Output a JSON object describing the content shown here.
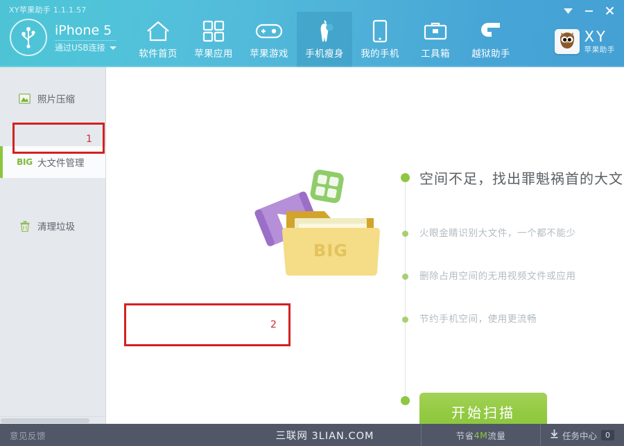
{
  "window": {
    "title": "XY苹果助手 1.1.1.57",
    "controls": [
      {
        "name": "dropdown-icon",
        "glyph": "▼"
      },
      {
        "name": "minimize-icon",
        "glyph": "—"
      },
      {
        "name": "close-icon",
        "glyph": "✕"
      }
    ]
  },
  "device": {
    "name": "iPhone 5",
    "connection": "通过USB连接",
    "icon": "usb-icon"
  },
  "nav": {
    "items": [
      {
        "label": "软件首页",
        "icon": "home-icon",
        "active": false
      },
      {
        "label": "苹果应用",
        "icon": "apps-grid-icon",
        "active": false
      },
      {
        "label": "苹果游戏",
        "icon": "gamepad-icon",
        "active": false
      },
      {
        "label": "手机瘦身",
        "icon": "apple-slim-icon",
        "active": true
      },
      {
        "label": "我的手机",
        "icon": "phone-icon",
        "active": false
      },
      {
        "label": "工具箱",
        "icon": "toolbox-icon",
        "active": false
      },
      {
        "label": "越狱助手",
        "icon": "jailbreak-arrow-icon",
        "active": false
      }
    ]
  },
  "brand": {
    "title": "XY",
    "subtitle": "苹果助手",
    "icon": "owl-avatar-icon"
  },
  "sidebar": {
    "items": [
      {
        "label": "照片压缩",
        "icon": "photo-icon",
        "selected": false
      },
      {
        "label": "大文件管理",
        "icon": "big-badge-icon",
        "badge": "BIG",
        "selected": true
      },
      {
        "label": "清理垃圾",
        "icon": "trash-icon",
        "selected": false
      }
    ]
  },
  "annotations": [
    {
      "id": "1",
      "label": "1"
    },
    {
      "id": "2",
      "label": "2"
    }
  ],
  "illustration": {
    "folder_label": "BIG",
    "name": "big-files-folder-illustration"
  },
  "main": {
    "heading": "空间不足，找出罪魁祸首的大文件",
    "bullets": [
      "火眼金睛识别大文件，一个都不能少",
      "删除占用空间的无用视频文件或应用",
      "节约手机空间，使用更流畅"
    ],
    "scan_button": "开始扫描"
  },
  "status": {
    "feedback": "意见反馈",
    "watermark": "三联网 3LIAN.COM",
    "save_prefix": "节省",
    "save_amount": "4M",
    "save_suffix": "流量",
    "task_center": "任务中心",
    "task_count": "0"
  },
  "colors": {
    "header_start": "#4ec3d6",
    "header_end": "#45a0d4",
    "accent_green": "#8ec740",
    "annotation_red": "#d32020",
    "status_bar": "#515767",
    "sidebar_bg": "#e5e8ed"
  }
}
